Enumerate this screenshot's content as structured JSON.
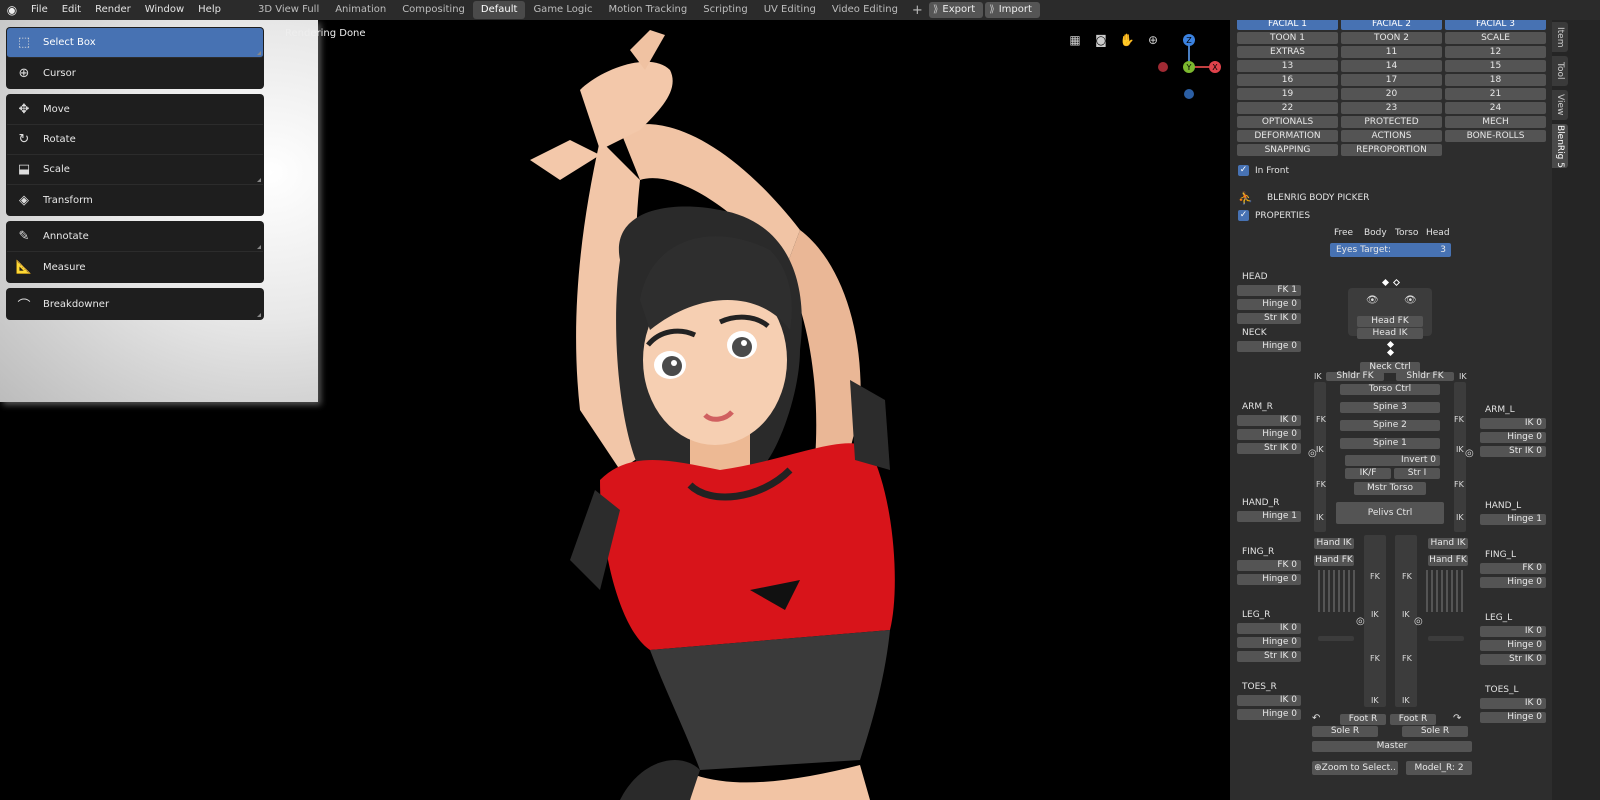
{
  "menu": {
    "items": [
      "File",
      "Edit",
      "Render",
      "Window",
      "Help"
    ]
  },
  "workspaces": {
    "tabs": [
      "3D View Full",
      "Animation",
      "Compositing",
      "Default",
      "Game Logic",
      "Motion Tracking",
      "Scripting",
      "UV Editing",
      "Video Editing"
    ],
    "active": "Default",
    "export_label": "Export",
    "import_label": "Import"
  },
  "viewport": {
    "status": "Rendering Done"
  },
  "toolbar": {
    "select_box": "Select Box",
    "cursor": "Cursor",
    "move": "Move",
    "rotate": "Rotate",
    "scale": "Scale",
    "transform": "Transform",
    "annotate": "Annotate",
    "measure": "Measure",
    "breakdowner": "Breakdowner"
  },
  "gizmo": {
    "z": "Z",
    "y": "Y",
    "x": "X"
  },
  "side_tabs": [
    "Item",
    "Tool",
    "View",
    "BlenRig 5"
  ],
  "layers": [
    [
      "FACIAL 1",
      "FACIAL 2",
      "FACIAL 3"
    ],
    [
      "TOON 1",
      "TOON 2",
      "SCALE"
    ],
    [
      "EXTRAS",
      "11",
      "12"
    ],
    [
      "13",
      "14",
      "15"
    ],
    [
      "16",
      "17",
      "18"
    ],
    [
      "19",
      "20",
      "21"
    ],
    [
      "22",
      "23",
      "24"
    ],
    [
      "OPTIONALS",
      "PROTECTED",
      "MECH"
    ],
    [
      "DEFORMATION",
      "ACTIONS",
      "BONE-ROLLS"
    ],
    [
      "SNAPPING",
      "REPROPORTION",
      ""
    ]
  ],
  "options": {
    "in_front": "In Front",
    "picker_title": "BLENRIG BODY PICKER",
    "properties": "PROPERTIES"
  },
  "eyes": {
    "modes": [
      "Free",
      "Body",
      "Torso",
      "Head"
    ],
    "target_label": "Eyes Target:",
    "target_value": "3"
  },
  "head": {
    "title": "HEAD",
    "fk": "FK 1",
    "hinge": "Hinge 0",
    "str_ik": "Str IK 0"
  },
  "neck": {
    "title": "NECK",
    "hinge": "Hinge 0"
  },
  "arm_r": {
    "title": "ARM_R",
    "ik": "IK 0",
    "hinge": "Hinge 0",
    "str_ik": "Str IK 0"
  },
  "arm_l": {
    "title": "ARM_L",
    "ik": "IK 0",
    "hinge": "Hinge 0",
    "str_ik": "Str IK 0"
  },
  "hand_r": {
    "title": "HAND_R",
    "hinge": "Hinge 1"
  },
  "hand_l": {
    "title": "HAND_L",
    "hinge": "Hinge 1"
  },
  "fing_r": {
    "title": "FING_R",
    "fk": "FK 0",
    "hinge": "Hinge 0"
  },
  "fing_l": {
    "title": "FING_L",
    "fk": "FK 0",
    "hinge": "Hinge 0"
  },
  "leg_r": {
    "title": "LEG_R",
    "ik": "IK 0",
    "hinge": "Hinge 0",
    "str_ik": "Str IK 0"
  },
  "leg_l": {
    "title": "LEG_L",
    "ik": "IK 0",
    "hinge": "Hinge 0",
    "str_ik": "Str IK 0"
  },
  "toes_r": {
    "title": "TOES_R",
    "ik": "IK 0",
    "hinge": "Hinge 0"
  },
  "toes_l": {
    "title": "TOES_L",
    "ik": "IK 0",
    "hinge": "Hinge 0"
  },
  "picker": {
    "head_fk": "Head FK",
    "head_ik": "Head IK",
    "neck_ctrl": "Neck Ctrl",
    "shldr_fk_r": "Shldr FK",
    "shldr_fk_l": "Shldr FK",
    "torso_ctrl": "Torso Ctrl",
    "spine3": "Spine 3",
    "spine2": "Spine 2",
    "spine1": "Spine 1",
    "invert": "Invert 0",
    "ikf": "IK/F",
    "str": "Str I",
    "mstr_torso": "Mstr Torso",
    "pelvis_ctrl": "Pelivs Ctrl",
    "hand_ik_r": "Hand IK",
    "hand_fk_r": "Hand FK",
    "hand_ik_l": "Hand IK",
    "hand_fk_l": "Hand FK",
    "foot_r1": "Foot R",
    "foot_r2": "Foot R",
    "sole_r1": "Sole R",
    "sole_r2": "Sole R",
    "master": "Master",
    "ik": "IK",
    "fk": "FK"
  },
  "bottom": {
    "zoom_label": "Zoom to Select..",
    "model": "Model_R: 2"
  }
}
